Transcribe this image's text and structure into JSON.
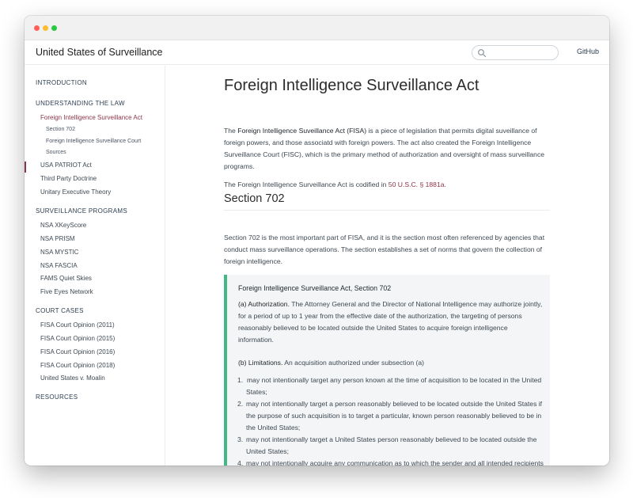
{
  "window": {
    "controls": [
      "close",
      "minimize",
      "zoom"
    ]
  },
  "header": {
    "site_title": "United States of Surveillance",
    "search_placeholder": "",
    "github_label": "GitHub"
  },
  "sidebar": {
    "introduction": "INTRODUCTION",
    "understanding": {
      "title": "UNDERSTANDING THE LAW",
      "items": [
        "Foreign Intelligence Surveillance Act",
        "Section 702",
        "Foreign Intelligence Surveillance Court",
        "Sources",
        "USA PATRIOT Act",
        "Third Party Doctrine",
        "Unitary Executive Theory"
      ]
    },
    "programs": {
      "title": "SURVEILLANCE PROGRAMS",
      "items": [
        "NSA XKeyScore",
        "NSA PRISM",
        "NSA MYSTIC",
        "NSA FASCIA",
        "FAMS Quiet Skies",
        "Five Eyes Network"
      ]
    },
    "court_cases": {
      "title": "COURT CASES",
      "items": [
        "FISA Court Opinion (2011)",
        "FISA Court Opinion (2015)",
        "FISA Court Opinion (2016)",
        "FISA Court Opinion (2018)",
        "United States v. Moalin"
      ]
    },
    "resources": "RESOURCES"
  },
  "content": {
    "title": "Foreign Intelligence Surveillance Act",
    "intro": {
      "prefix": "The ",
      "term": "Foreign Intelligence Suveillance Act (FISA)",
      "rest": " is a piece of legislation that permits digital suveillance of foreign powers, and those associatd with foreign powers. The act also created the Foreign Intelligence Surveillance Court (FISC), which is the primary method of authorization and oversight of mass surveillance programs."
    },
    "codified": {
      "prefix": "The Foreign Intelligence Surveillance Act is codified in ",
      "link": "50 U.S.C. § 1881a",
      "suffix": "."
    },
    "section_heading": "Section 702",
    "section_para": "Section 702 is the most important part of FISA, and it is the section most often referenced by agencies that conduct mass surveillance operations. The section establishes a set of norms that govern the collection of foreign intelligence.",
    "blockquote": {
      "title": "Foreign Intelligence Surveillance Act, Section 702",
      "a_lead": "(a) Authorization.",
      "a_text": " The Attorney General and the Director of National Intelligence may authorize jointly, for a period of up to 1 year from the effective date of the authorization, the targeting of persons reasonably believed to be located outside the United States to acquire foreign intelligence information.",
      "b_lead": "(b) Limitations.",
      "b_text": " An acquisition authorized under subsection (a)",
      "list": [
        {
          "num": "1.",
          "text": "may not intentionally target any person known at the time of acquisition to be located in the United States;"
        },
        {
          "num": "2.",
          "text": "may not intentionally target a person reasonably believed to be located outside the United States if the purpose of such acquisition is to target a particular, known person reasonably believed to be in the United States;"
        },
        {
          "num": "3.",
          "text": "may not intentionally target a United States person reasonably believed to be located outside the United States;"
        },
        {
          "num": "4.",
          "text": "may not intentionally acquire any communication as to which the sender and all intended recipients are known at the time of the acquisition to be located in the United States; and"
        }
      ]
    }
  },
  "colors": {
    "accent": "#8e3549",
    "quote_border": "#42b883",
    "quote_bg": "#f3f5f7"
  }
}
